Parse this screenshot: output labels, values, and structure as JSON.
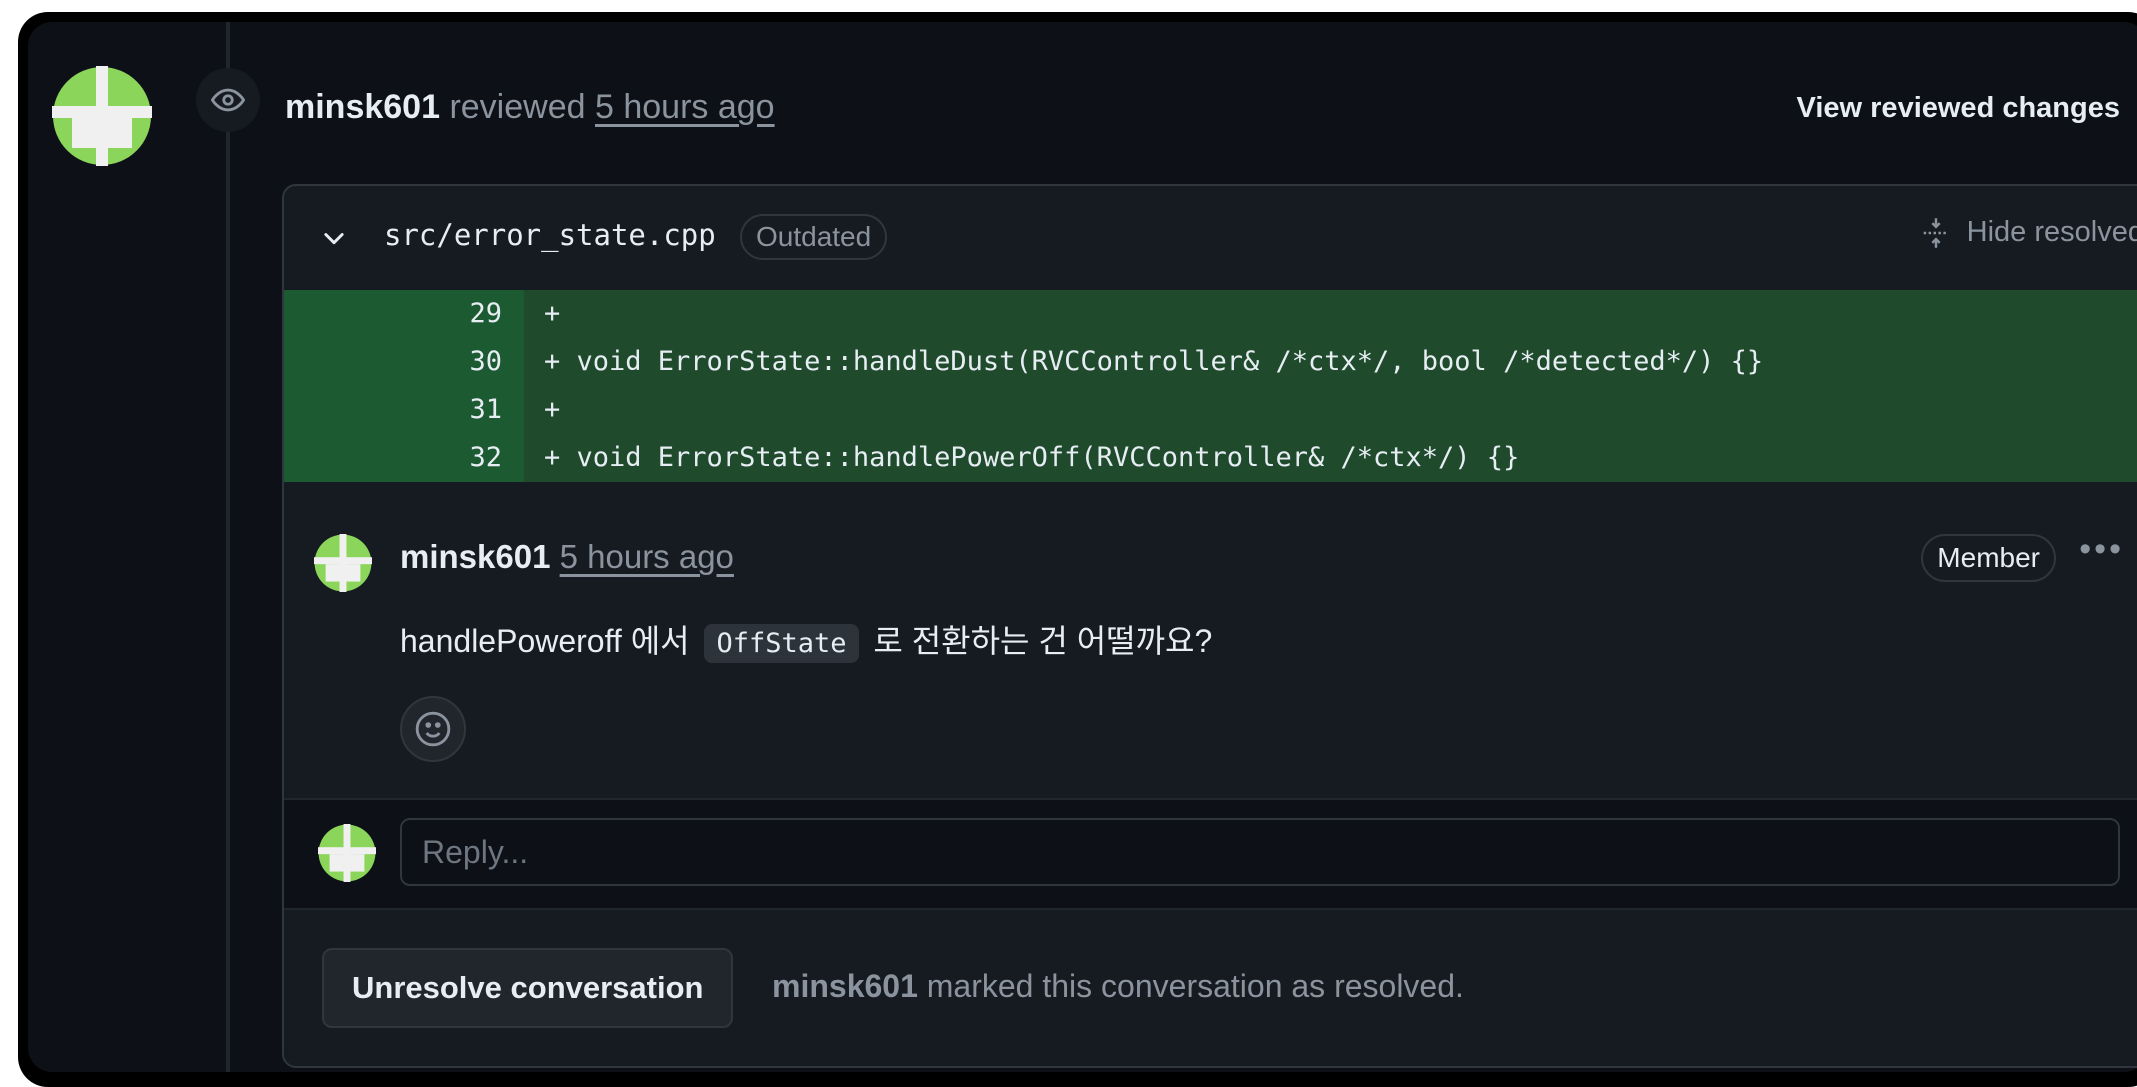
{
  "review": {
    "author": "minsk601",
    "action": "reviewed",
    "time": "5 hours ago",
    "view_changes_label": "View reviewed changes"
  },
  "file": {
    "path": "src/error_state.cpp",
    "badge": "Outdated",
    "hide_resolved_label": "Hide resolved"
  },
  "code_lines": [
    {
      "num": "29",
      "text": "+"
    },
    {
      "num": "30",
      "text": "+ void ErrorState::handleDust(RVCController& /*ctx*/, bool /*detected*/) {}"
    },
    {
      "num": "31",
      "text": "+"
    },
    {
      "num": "32",
      "text": "+ void ErrorState::handlePowerOff(RVCController& /*ctx*/) {}"
    }
  ],
  "comment": {
    "author": "minsk601",
    "time": "5 hours ago",
    "badge": "Member",
    "more_label": "•••",
    "body_before": "handlePoweroff 에서",
    "body_code": "OffState",
    "body_after": "로 전환하는 건 어떨까요?"
  },
  "reply": {
    "placeholder": "Reply..."
  },
  "resolution": {
    "button_label": "Unresolve conversation",
    "author": "minsk601",
    "text": "marked this conversation as resolved."
  },
  "colors": {
    "background": "#0d1117",
    "card": "#161b22",
    "added_line": "#1f4a2c",
    "added_gutter": "#1c5a31",
    "avatar_green": "#8bd55a"
  },
  "icons": [
    "eye-icon",
    "chevron-down-icon",
    "fold-icon",
    "smiley-icon",
    "kebab-icon"
  ]
}
